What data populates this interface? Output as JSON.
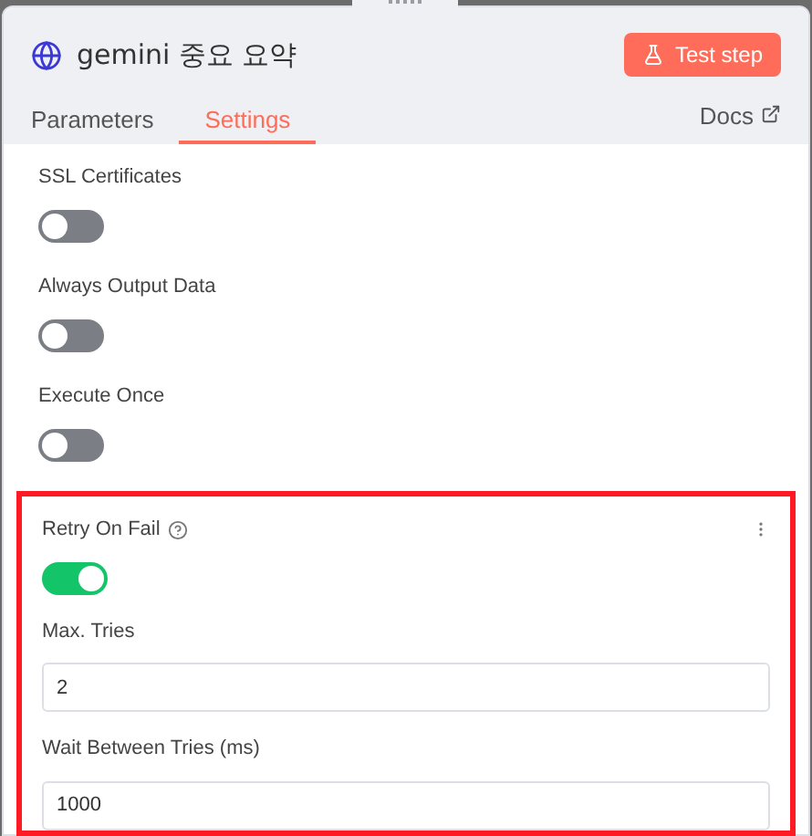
{
  "header": {
    "title": "gemini 중요 요약",
    "test_button": "Test step"
  },
  "tabs": [
    {
      "label": "Parameters",
      "selected": false
    },
    {
      "label": "Settings",
      "selected": true
    }
  ],
  "docs_link": "Docs",
  "settings": [
    {
      "kind": "toggle",
      "label": "SSL Certificates",
      "on": false
    },
    {
      "kind": "toggle",
      "label": "Always Output Data",
      "on": false
    },
    {
      "kind": "toggle",
      "label": "Execute Once",
      "on": false
    }
  ],
  "retry": {
    "label": "Retry On Fail",
    "on": true,
    "highlighted": true,
    "fields": [
      {
        "label": "Max. Tries",
        "value": "2"
      },
      {
        "label": "Wait Between Tries (ms)",
        "value": "1000"
      }
    ]
  }
}
